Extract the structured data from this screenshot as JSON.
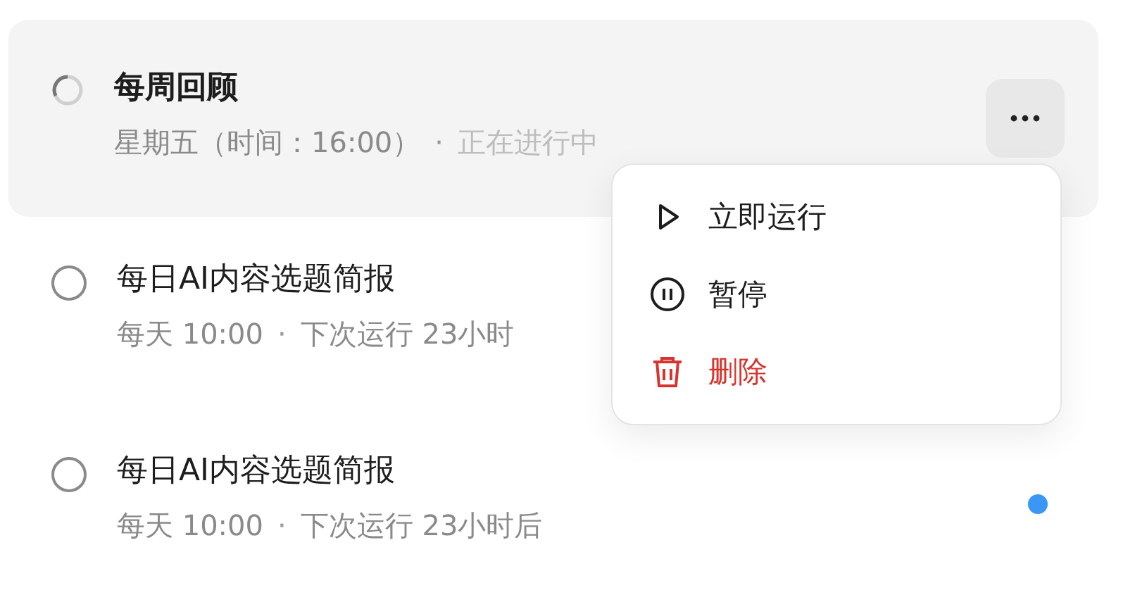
{
  "tasks": [
    {
      "title": "每周回顾",
      "schedule": "星期五（时间：16:00）",
      "separator": "·",
      "status": "正在进行中",
      "kind": "running",
      "highlighted": true,
      "unread": false,
      "menu_open": true
    },
    {
      "title": "每日AI内容选题简报",
      "schedule": "每天 10:00",
      "separator": "·",
      "status": "下次运行 23小时",
      "kind": "idle",
      "highlighted": false,
      "menu_open": false
    },
    {
      "title": "每日AI内容选题简报",
      "schedule": "每天 10:00",
      "separator": "·",
      "status": "下次运行 23小时后",
      "kind": "idle",
      "highlighted": false,
      "unread": true,
      "menu_open": false
    }
  ],
  "menu": {
    "items": [
      {
        "label": "立即运行",
        "kind": "run"
      },
      {
        "label": "暂停",
        "kind": "pause"
      },
      {
        "label": "删除",
        "kind": "delete"
      }
    ]
  }
}
